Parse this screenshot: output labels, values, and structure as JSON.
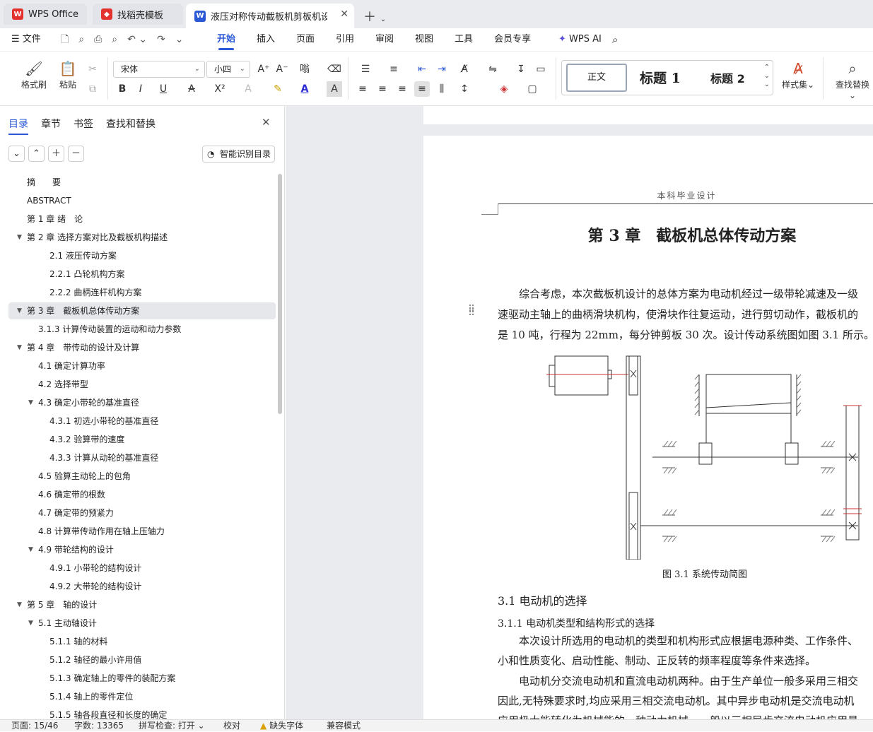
{
  "tabs": [
    {
      "label": "WPS Office",
      "icon": "wps-logo-icon",
      "color": "#e3312d"
    },
    {
      "label": "找稻壳模板",
      "icon": "docer-icon",
      "color": "#e3312d"
    },
    {
      "label": "液压对称传动截板机剪板机设计",
      "icon": "word-doc-icon",
      "color": "#2b59d6"
    }
  ],
  "menu": {
    "file": "文件",
    "items": [
      "开始",
      "插入",
      "页面",
      "引用",
      "审阅",
      "视图",
      "工具",
      "会员专享"
    ],
    "active": "开始",
    "ai": "WPS AI"
  },
  "ribbon": {
    "format_painter": "格式刷",
    "paste": "粘贴",
    "font_name": "宋体",
    "font_size": "小四",
    "styles": {
      "normal": "正文",
      "h1": "标题 1",
      "h2": "标题 2"
    },
    "style_set": "样式集",
    "find_replace": "查找替换"
  },
  "panel": {
    "tabs": [
      "目录",
      "章节",
      "书签",
      "查找和替换"
    ],
    "smart_btn": "智能识别目录",
    "toc": [
      {
        "label": "摘　　要",
        "level": 0,
        "tri": ""
      },
      {
        "label": "ABSTRACT",
        "level": 0,
        "tri": ""
      },
      {
        "label": "第 1 章  绪　论",
        "level": 0,
        "tri": ""
      },
      {
        "label": "第 2 章  选择方案对比及截板机构描述",
        "level": 0,
        "tri": "▼"
      },
      {
        "label": "2.1 液压传动方案",
        "level": 2,
        "tri": ""
      },
      {
        "label": "2.2.1 凸轮机构方案",
        "level": 2,
        "tri": ""
      },
      {
        "label": "2.2.2 曲柄连杆机构方案",
        "level": 2,
        "tri": ""
      },
      {
        "label": "第 3 章　截板机总体传动方案",
        "level": 0,
        "tri": "▼",
        "selected": true
      },
      {
        "label": "3.1.3 计算传动装置的运动和动力参数",
        "level": 1,
        "tri": ""
      },
      {
        "label": "第 4 章　带传动的设计及计算",
        "level": 0,
        "tri": "▼"
      },
      {
        "label": "4.1  确定计算功率",
        "level": 1,
        "tri": ""
      },
      {
        "label": "4.2  选择带型",
        "level": 1,
        "tri": ""
      },
      {
        "label": "4.3  确定小带轮的基准直径",
        "level": 1,
        "tri": "▼"
      },
      {
        "label": "4.3.1 初选小带轮的基准直径",
        "level": 2,
        "tri": ""
      },
      {
        "label": "4.3.2 验算带的速度",
        "level": 2,
        "tri": ""
      },
      {
        "label": "4.3.3 计算从动轮的基准直径",
        "level": 2,
        "tri": ""
      },
      {
        "label": "4.5 验算主动轮上的包角",
        "level": 1,
        "tri": ""
      },
      {
        "label": "4.6 确定带的根数",
        "level": 1,
        "tri": ""
      },
      {
        "label": "4.7  确定带的预紧力",
        "level": 1,
        "tri": ""
      },
      {
        "label": "4.8 计算带传动作用在轴上压轴力",
        "level": 1,
        "tri": ""
      },
      {
        "label": "4.9  带轮结构的设计",
        "level": 1,
        "tri": "▼"
      },
      {
        "label": "4.9.1 小带轮的结构设计",
        "level": 2,
        "tri": ""
      },
      {
        "label": "4.9.2 大带轮的结构设计",
        "level": 2,
        "tri": ""
      },
      {
        "label": "第 5 章　轴的设计",
        "level": 0,
        "tri": "▼"
      },
      {
        "label": "5.1 主动轴设计",
        "level": 1,
        "tri": "▼"
      },
      {
        "label": "5.1.1 轴的材料",
        "level": 2,
        "tri": ""
      },
      {
        "label": "5.1.2  轴径的最小许用值",
        "level": 2,
        "tri": ""
      },
      {
        "label": "5.1.3 确定轴上的零件的装配方案",
        "level": 2,
        "tri": ""
      },
      {
        "label": "5.1.4  轴上的零件定位",
        "level": 2,
        "tri": ""
      },
      {
        "label": "5.1.5 轴各段直径和长度的确定",
        "level": 2,
        "tri": ""
      }
    ]
  },
  "doc": {
    "header": "本科毕业设计",
    "chapter_title": "第 3 章　截板机总体传动方案",
    "para1": [
      "综合考虑，本次截板机设计的总体方案为电动机经过一级带轮减速及一级",
      "速驱动主轴上的曲柄滑块机构，使滑块作往复运动，进行剪切动作，截板机的",
      "是 10 吨，行程为 22mm，每分钟剪板 30 次。设计传动系统图如图 3.1 所示。"
    ],
    "figure_caption": "图 3.1  系统传动简图",
    "sec31": "3.1 电动机的选择",
    "sec311": "3.1.1 电动机类型和结构形式的选择",
    "para2": [
      "本次设计所选用的电动机的类型和机构形式应根据电源种类、工作条件、",
      "小和性质变化、启动性能、制动、正反转的频率程度等条件来选择。"
    ],
    "para3": [
      "电动机分交流电动机和直流电动机两种。由于生产单位一般多采用三相交",
      "因此,无特殊要求时,均应采用三相交流电动机。其中异步电动机是交流电动机",
      "应用极大能转化为机械能的一种动力机械，一般以三相异步交流电动机应用最"
    ]
  },
  "status": {
    "page": "页面: 15/46",
    "words": "字数: 13365",
    "spell": "拼写检查: 打开",
    "proof": "校对",
    "missing_font": "缺失字体",
    "compat": "兼容模式"
  }
}
